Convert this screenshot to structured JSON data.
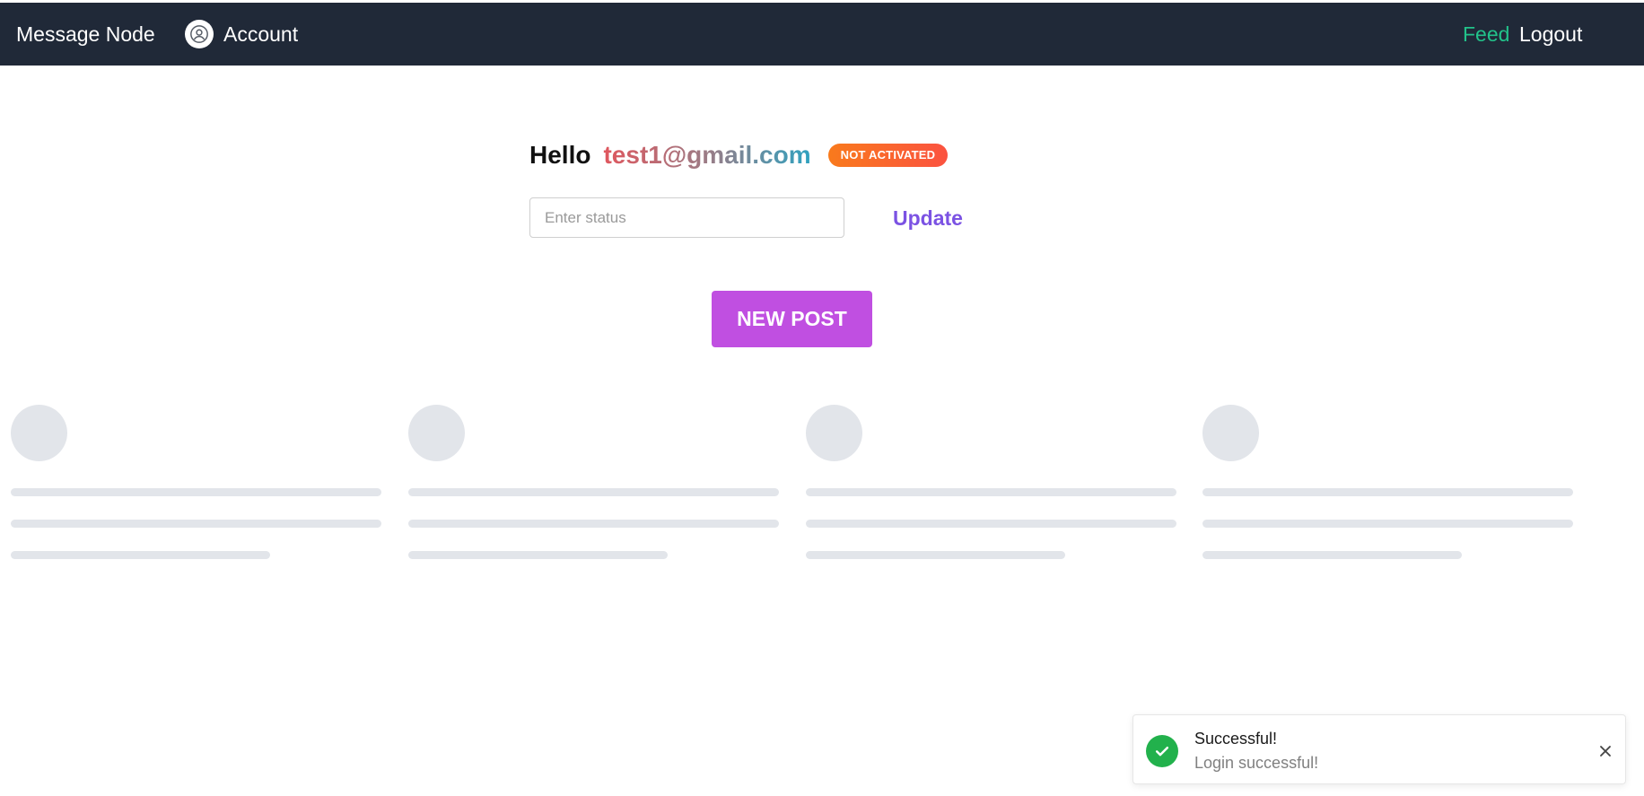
{
  "topbar": {
    "brand": "Message Node",
    "account_label": "Account",
    "account_icon": "user-circle-icon",
    "nav": {
      "feed": "Feed",
      "logout": "Logout"
    },
    "colors": {
      "background": "#202938",
      "feed_active": "#22c28a"
    }
  },
  "profile": {
    "greeting": "Hello",
    "email": "test1@gmail.com",
    "badge": "NOT ACTIVATED",
    "status_input": {
      "value": "",
      "placeholder": "Enter status"
    },
    "update_label": "Update"
  },
  "actions": {
    "new_post_label": "NEW POST",
    "new_post_color": "#c04fe1"
  },
  "feed": {
    "skeleton_placeholder_count": 4
  },
  "toast": {
    "icon": "check-icon",
    "title": "Successful!",
    "message": "Login successful!",
    "close_icon": "close-icon",
    "color": "#22b14c"
  }
}
